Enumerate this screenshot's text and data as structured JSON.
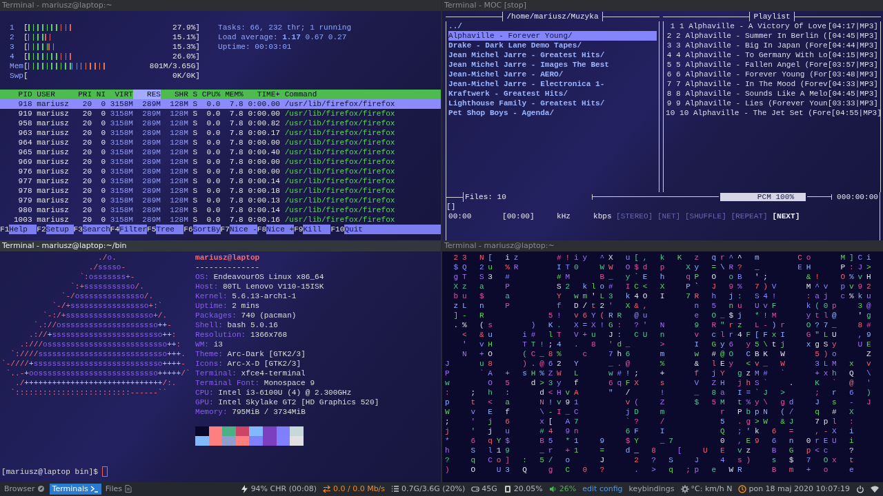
{
  "panes": [
    {
      "kind": "htop",
      "title": "Terminal - mariusz@laptop:~",
      "focused": false,
      "meters": [
        {
          "kind": "cpu",
          "label": "1",
          "bracket": "[",
          "reading": "27.9%]"
        },
        {
          "kind": "cpu",
          "label": "2",
          "bracket": "[",
          "reading": "15.1%]"
        },
        {
          "kind": "cpu",
          "label": "3",
          "bracket": "[",
          "reading": "15.3%]"
        },
        {
          "kind": "cpu",
          "label": "4",
          "bracket": "[",
          "reading": "26.0%]"
        },
        {
          "kind": "mem",
          "label": "Mem",
          "bracket": "[",
          "reading": "801M/3.65G]"
        },
        {
          "kind": "swap",
          "label": "Swp",
          "bracket": "[",
          "reading": "0K/0K]"
        }
      ],
      "summary": [
        "Tasks: 66, 232 thr; 1 running",
        "Load average: **1.17** 0.67 0.27",
        "Uptime: 00:03:01"
      ],
      "table": {
        "columns": [
          {
            "label": "PID",
            "sorted": false
          },
          {
            "label": "USER",
            "sorted": false
          },
          {
            "label": "PRI",
            "sorted": false
          },
          {
            "label": "NI",
            "sorted": false
          },
          {
            "label": "VIRT",
            "sorted": false
          },
          {
            "label": "RES",
            "sorted": true
          },
          {
            "label": "SHR",
            "sorted": false
          },
          {
            "label": "S",
            "sorted": false
          },
          {
            "label": "CPU%",
            "sorted": false
          },
          {
            "label": "MEM%",
            "sorted": false
          },
          {
            "label": "TIME+",
            "sorted": false
          },
          {
            "label": "Command",
            "sorted": false
          }
        ],
        "rows": [
          {
            "selected": true,
            "cells": [
              "918",
              "mariusz",
              "20",
              "0",
              "3158M",
              "289M",
              "128M",
              "S",
              "0.0",
              "7.8",
              "0:00.00",
              "/usr/lib/firefox/firefox"
            ]
          },
          {
            "selected": false,
            "cells": [
              "919",
              "mariusz",
              "20",
              "0",
              "3158M",
              "289M",
              "128M",
              "S",
              "0.0",
              "7.8",
              "0:00.00",
              "/usr/lib/firefox/firefox"
            ]
          },
          {
            "selected": false,
            "cells": [
              "958",
              "mariusz",
              "20",
              "0",
              "3158M",
              "289M",
              "128M",
              "S",
              "0.0",
              "7.8",
              "0:00.82",
              "/usr/lib/firefox/firefox"
            ]
          },
          {
            "selected": false,
            "cells": [
              "963",
              "mariusz",
              "20",
              "0",
              "3158M",
              "289M",
              "128M",
              "S",
              "0.0",
              "7.8",
              "0:00.17",
              "/usr/lib/firefox/firefox"
            ]
          },
          {
            "selected": false,
            "cells": [
              "964",
              "mariusz",
              "20",
              "0",
              "3158M",
              "289M",
              "128M",
              "S",
              "0.0",
              "7.8",
              "0:00.00",
              "/usr/lib/firefox/firefox"
            ]
          },
          {
            "selected": false,
            "cells": [
              "965",
              "mariusz",
              "20",
              "0",
              "3158M",
              "289M",
              "128M",
              "S",
              "0.0",
              "7.8",
              "0:00.40",
              "/usr/lib/firefox/firefox"
            ]
          },
          {
            "selected": false,
            "cells": [
              "969",
              "mariusz",
              "20",
              "0",
              "3158M",
              "289M",
              "128M",
              "S",
              "0.0",
              "7.8",
              "0:00.00",
              "/usr/lib/firefox/firefox"
            ]
          },
          {
            "selected": false,
            "cells": [
              "976",
              "mariusz",
              "20",
              "0",
              "3158M",
              "289M",
              "128M",
              "S",
              "0.0",
              "7.8",
              "0:00.00",
              "/usr/lib/firefox/firefox"
            ]
          },
          {
            "selected": false,
            "cells": [
              "977",
              "mariusz",
              "20",
              "0",
              "3158M",
              "289M",
              "128M",
              "S",
              "0.0",
              "7.8",
              "0:00.14",
              "/usr/lib/firefox/firefox"
            ]
          },
          {
            "selected": false,
            "cells": [
              "978",
              "mariusz",
              "20",
              "0",
              "3158M",
              "289M",
              "128M",
              "S",
              "0.0",
              "7.8",
              "0:00.18",
              "/usr/lib/firefox/firefox"
            ]
          },
          {
            "selected": false,
            "cells": [
              "979",
              "mariusz",
              "20",
              "0",
              "3158M",
              "289M",
              "128M",
              "S",
              "0.0",
              "7.8",
              "0:00.13",
              "/usr/lib/firefox/firefox"
            ]
          },
          {
            "selected": false,
            "cells": [
              "980",
              "mariusz",
              "20",
              "0",
              "3158M",
              "289M",
              "128M",
              "S",
              "0.0",
              "7.8",
              "0:00.14",
              "/usr/lib/firefox/firefox"
            ]
          },
          {
            "selected": false,
            "cells": [
              "1003",
              "mariusz",
              "20",
              "0",
              "3158M",
              "289M",
              "128M",
              "S",
              "0.0",
              "7.8",
              "0:00.16",
              "/usr/lib/firefox/firefox"
            ]
          }
        ]
      },
      "function_keys": [
        {
          "key": "F1",
          "label": "Help"
        },
        {
          "key": "F2",
          "label": "Setup"
        },
        {
          "key": "F3",
          "label": "Search"
        },
        {
          "key": "F4",
          "label": "Filter"
        },
        {
          "key": "F5",
          "label": "Tree"
        },
        {
          "key": "F6",
          "label": "SortBy"
        },
        {
          "key": "F7",
          "label": "Nice -"
        },
        {
          "key": "F8",
          "label": "Nice +"
        },
        {
          "key": "F9",
          "label": "Kill"
        },
        {
          "key": "F10",
          "label": "Quit"
        }
      ]
    },
    {
      "kind": "moc",
      "title": "Terminal - MOC [stop]",
      "focused": false,
      "directory": {
        "title": "/home/mariusz/Muzyka",
        "items": [
          {
            "label": "../",
            "selected": false
          },
          {
            "label": "Alphaville - Forever Young/",
            "selected": true
          },
          {
            "label": "Drake - Dark Lane Demo Tapes/",
            "selected": false
          },
          {
            "label": "Jean Michel Jarre - Greatest Hits/",
            "selected": false
          },
          {
            "label": "Jean Michel Jarre - Images The Best",
            "selected": false
          },
          {
            "label": "Jean-Michel Jarre - AERO/",
            "selected": false
          },
          {
            "label": "Jean-Michel Jarre - Electronica 1-",
            "selected": false
          },
          {
            "label": "Kraftwerk - Greatest Hits/",
            "selected": false
          },
          {
            "label": "Lighthouse Family - Greatest Hits/",
            "selected": false
          },
          {
            "label": "Pet Shop Boys - Agenda/",
            "selected": false
          }
        ]
      },
      "playlist": {
        "title": "Playlist",
        "items": [
          {
            "number": "1",
            "title": "1 Alphaville - A Victory Of Love",
            "time": "[04:17|MP3]"
          },
          {
            "number": "2",
            "title": "2 Alphaville - Summer In Berlin (",
            "time": "[04:45|MP3]"
          },
          {
            "number": "3",
            "title": "3 Alphaville - Big In Japan (Fore",
            "time": "[04:44|MP3]"
          },
          {
            "number": "4",
            "title": "4 Alphaville - To Germany With Lo",
            "time": "[04:15|MP3]"
          },
          {
            "number": "5",
            "title": "5 Alphaville - Fallen Angel (Fore",
            "time": "[03:57|MP3]"
          },
          {
            "number": "6",
            "title": "6 Alphaville - Forever Young (For",
            "time": "[03:48|MP3]"
          },
          {
            "number": "7",
            "title": "7 Alphaville - In The Mood (Forev",
            "time": "[04:33|MP3]"
          },
          {
            "number": "8",
            "title": "8 Alphaville - Sounds Like A Melo",
            "time": "[04:45|MP3]"
          },
          {
            "number": "9",
            "title": "9 Alphaville - Lies (Forever Youn",
            "time": "[03:33|MP3]"
          },
          {
            "number": "10",
            "title": "10 Alphaville - The Jet Set (Fore",
            "time": "[04:55|MP3]"
          }
        ]
      },
      "files": "Files: 10",
      "volume": {
        "label": "PCM 100%"
      },
      "clock": "000:00:00",
      "track": "[]",
      "elapsed": "00:00",
      "total": "[00:00]",
      "rate": "kHz",
      "bitrate": "kbps",
      "flags": [
        {
          "label": "[STEREO]",
          "on": false
        },
        {
          "label": "[NET]",
          "on": false
        },
        {
          "label": "[SHUFFLE]",
          "on": false
        },
        {
          "label": "[REPEAT]",
          "on": false
        },
        {
          "label": "[NEXT]",
          "on": true
        }
      ]
    },
    {
      "kind": "neofetch",
      "title": "Terminal - mariusz@laptop:~/bin",
      "focused": true,
      "art": [
        "                     ./o.",
        "                   ./sssso-",
        "                 `:osssssss+-",
        "               `:+sssssssssso/.",
        "             `-/ossssssssssssso/.",
        "           `-/+sssssssssssssssso+:`",
        "         `-:/+sssssssssssssssssso+/.",
        "       `.://osssssssssssssssssssso++-",
        "      .://+ssssssssssssssssssssssso++:",
        "    .:///ossssssssssssssssssssssssso++:",
        "  `:////ssssssssssssssssssssssssssso+++.",
        "`-////+ssssssssssssssssssssssssssso++++-",
        " `..-+oossssssssssssssssssssssssso+++++/`",
        "   ./++++++++++++++++++++++++++++++/:.",
        "  `:::::::::::::::::::::::::------``"
      ],
      "user": "mariusz@laptop",
      "rule": "--------------",
      "info": [
        {
          "key": "OS:",
          "value": "EndeavourOS Linux x86_64"
        },
        {
          "key": "Host:",
          "value": "80TL Lenovo V110-15ISK"
        },
        {
          "key": "Kernel:",
          "value": "5.6.13-arch1-1"
        },
        {
          "key": "Uptime:",
          "value": "2 mins"
        },
        {
          "key": "Packages:",
          "value": "740 (pacman)"
        },
        {
          "key": "Shell:",
          "value": "bash 5.0.16"
        },
        {
          "key": "Resolution:",
          "value": "1366x768"
        },
        {
          "key": "WM:",
          "value": "i3"
        },
        {
          "key": "Theme:",
          "value": "Arc-Dark [GTK2/3]"
        },
        {
          "key": "Icons:",
          "value": "Arc-X-D [GTK2/3]"
        },
        {
          "key": "Terminal:",
          "value": "xfce4-terminal"
        },
        {
          "key": "Terminal Font:",
          "value": "Monospace 9"
        },
        {
          "key": "CPU:",
          "value": "Intel i3-6100U (4) @ 2.300GHz"
        },
        {
          "key": "GPU:",
          "value": "Intel Skylake GT2 [HD Graphics 520]"
        },
        {
          "key": "Memory:",
          "value": "795MiB / 3734MiB"
        }
      ],
      "palette": [
        {
          "color": "#090828"
        },
        {
          "color": "#fe7f7f"
        },
        {
          "color": "#4caf85"
        },
        {
          "color": "#cc4466"
        },
        {
          "color": "#82b9fd"
        },
        {
          "color": "#7b3fc0"
        },
        {
          "color": "#7f7ffd"
        },
        {
          "color": "#c8d8d8"
        },
        {
          "color": "#82b9fd"
        },
        {
          "color": "#fe7f7f"
        },
        {
          "color": "#909ccc"
        },
        {
          "color": "#fe7f7f"
        },
        {
          "color": "#8080fd"
        },
        {
          "color": "#7b3fc0"
        },
        {
          "color": "#8080fd"
        },
        {
          "color": "#e0e0e0"
        }
      ],
      "prompt": "[mariusz@laptop bin]$"
    },
    {
      "kind": "matrix",
      "title": "Terminal - mariusz@laptop:~",
      "focused": false,
      "lines": [
        " 23 N[ iz    #!iy ^X u[, k K z qr^^ m    Co   M]Ci",
        " $Q 2u %R    IT0  WW O$d p  Xy =\\R? _    EH   P:J>",
        " gT S3 #     #M   B_ y`E h  qP O oB ';    &!  O%vH",
        " Xz a  P     S2 klo# IC< X  P` J 9% 7)V   M^v pv92",
        " bu $  a     Y wm'L3 k4O I  7R h j: S4!   :aj c%ku",
        " zL n  P     f D/t2' X&,     n 5 nu UvF   k(0p  3@",
        [
          " ]- R       ",
          "5! v6Y(RR @u     e O_$j *!M   ytl@  'g"
        ],
        " .% (s    ) K. X=X!G: ?' N   9 R\"rz L-)r  O?7_  8#",
        "  < &u   i# lT V+u J: CU n   v clr4F[FxI  G\"LU  ,9",
        "  ' vH   TT!;4 . 8 'd_   >   I Gy6 y5\\tj  xgSy  UE",
        "  N +O   (C_8%  c  7h6   m   w #@O CBK W   5)o   Z",
        "J   u8   ).@62 Y   _.@   %   & lEy <v_ W   3LM x v",
        "P   `A + sH%ZW L   w#!;  +   f jY gzM# `   +xh Q \\",
        "w    O 5  d>3y f   6qFX  s   V ZH jhS`  .  K ` @ '",
        ":  ; h :   d<HvA   \" /   !   _ 8a I=`J >   ; r 6 )",
        "p  t < a   N!v91     v(  Z   $ 5M t%y\\ gd  J s - J",
        [
          "W  v E f   \\-I_C     jD  m      ",
          "r PbpN (/  q # X"
        ],
        [
          ";  ' j 6   x[ A7     `?  /      ",
          "5 .g>W &J  7pl :"
        ],
        [
          "j  ' j u   #4 9n     6F  I      ",
          "Q ;'k 6 =  ,-X i"
        ],
        "*  6 qY$   B5 *1  9  $Y  _7     0 ,E9 6 n 0rEU i",
        "h  S l19   _r +1  =  d_ 8  [  U E vz  B G p<c  ?",
        "?  q Co] : 5/ o   J   2 ? S  J  4 s)  s $ 7 Ox t",
        ")  O  U3 Q  g C 0 ?   . > q ;p e WR   B m + o  e"
      ]
    }
  ],
  "status_bar": {
    "workspaces": [
      {
        "kind": "browser",
        "label": "Browser",
        "selected": false
      },
      {
        "kind": "terminal",
        "label": "Terminals",
        "selected": true
      },
      {
        "kind": "files",
        "label": "Files",
        "selected": false
      }
    ],
    "indicators": [
      {
        "kind": "battery",
        "text": "94% CHR (00:08)"
      },
      {
        "kind": "network",
        "text": "0.0 / 0.0 Mb/s"
      },
      {
        "kind": "memory",
        "text": "0.7G/3.6G (20%)"
      },
      {
        "kind": "disk",
        "text": "45G"
      },
      {
        "kind": "cpu",
        "text": "20.05%"
      },
      {
        "kind": "volume",
        "text": "26%"
      },
      {
        "kind": "link",
        "text": "edit config"
      },
      {
        "kind": "plain",
        "text": "keybindings"
      },
      {
        "kind": "weather",
        "text": "°C: km/h N"
      },
      {
        "kind": "clock",
        "text": "pon 18 maj 2020 10:07:19"
      },
      {
        "kind": "power"
      },
      {
        "kind": "wifi"
      }
    ]
  }
}
